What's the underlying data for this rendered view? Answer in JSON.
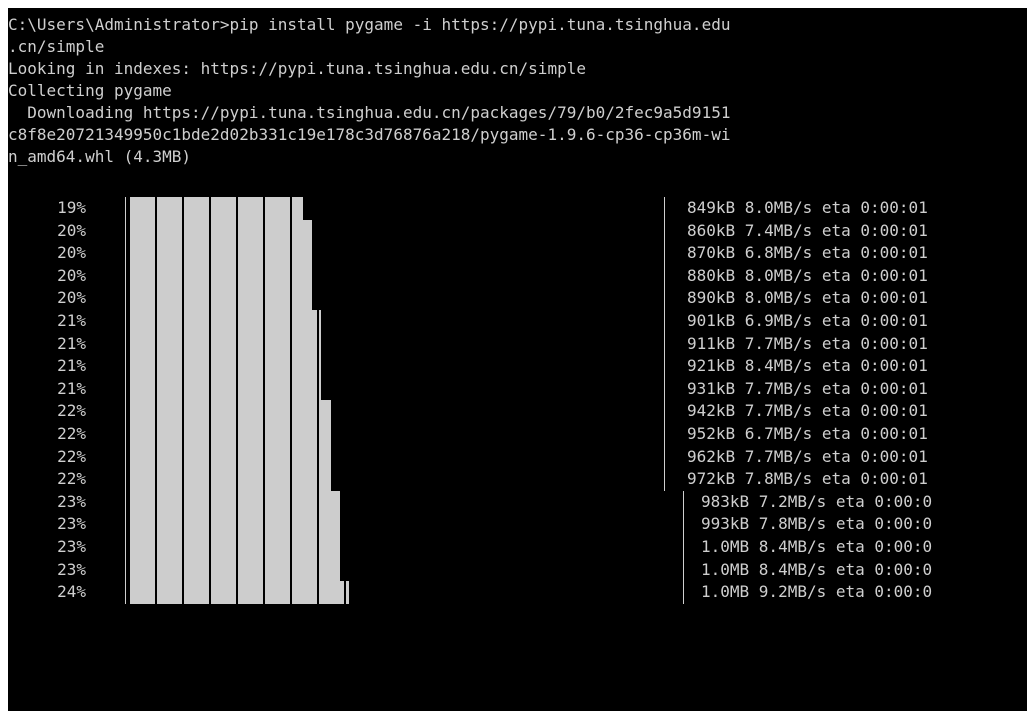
{
  "console": {
    "lines": [
      "C:\\Users\\Administrator>pip install pygame -i https://pypi.tuna.tsinghua.edu",
      ".cn/simple",
      "Looking in indexes: https://pypi.tuna.tsinghua.edu.cn/simple",
      "Collecting pygame",
      "  Downloading https://pypi.tuna.tsinghua.edu.cn/packages/79/b0/2fec9a5d9151",
      "c8f8e20721349950c1bde2d02b331c19e178c3d76876a218/pygame-1.9.6-cp36-cp36m-wi",
      "n_amd64.whl (4.3MB)"
    ],
    "progress_rows": [
      {
        "percent": "19%",
        "stats": "849kB 8.0MB/s eta 0:00:01",
        "fill": 0.19
      },
      {
        "percent": "20%",
        "stats": "860kB 7.4MB/s eta 0:00:01",
        "fill": 0.2
      },
      {
        "percent": "20%",
        "stats": "870kB 6.8MB/s eta 0:00:01",
        "fill": 0.2
      },
      {
        "percent": "20%",
        "stats": "880kB 8.0MB/s eta 0:00:01",
        "fill": 0.2
      },
      {
        "percent": "20%",
        "stats": "890kB 8.0MB/s eta 0:00:01",
        "fill": 0.2
      },
      {
        "percent": "21%",
        "stats": "901kB 6.9MB/s eta 0:00:01",
        "fill": 0.21
      },
      {
        "percent": "21%",
        "stats": "911kB 7.7MB/s eta 0:00:01",
        "fill": 0.21
      },
      {
        "percent": "21%",
        "stats": "921kB 8.4MB/s eta 0:00:01",
        "fill": 0.21
      },
      {
        "percent": "21%",
        "stats": "931kB 7.7MB/s eta 0:00:01",
        "fill": 0.21
      },
      {
        "percent": "22%",
        "stats": "942kB 7.7MB/s eta 0:00:01",
        "fill": 0.22
      },
      {
        "percent": "22%",
        "stats": "952kB 6.7MB/s eta 0:00:01",
        "fill": 0.22
      },
      {
        "percent": "22%",
        "stats": "962kB 7.7MB/s eta 0:00:01",
        "fill": 0.22
      },
      {
        "percent": "22%",
        "stats": "972kB 7.8MB/s eta 0:00:01",
        "fill": 0.22
      },
      {
        "percent": "23%",
        "stats": "983kB 7.2MB/s eta 0:00:0",
        "fill": 0.23
      },
      {
        "percent": "23%",
        "stats": "993kB 7.8MB/s eta 0:00:0",
        "fill": 0.23
      },
      {
        "percent": "23%",
        "stats": "1.0MB 8.4MB/s eta 0:00:0",
        "fill": 0.23
      },
      {
        "percent": "23%",
        "stats": "1.0MB 8.4MB/s eta 0:00:0",
        "fill": 0.23
      },
      {
        "percent": "24%",
        "stats": "1.0MB 9.2MB/s eta 0:00:0",
        "fill": 0.24
      }
    ]
  },
  "colors": {
    "background": "#000000",
    "text": "#cfcfcf",
    "bar": "#cdcdcd"
  }
}
